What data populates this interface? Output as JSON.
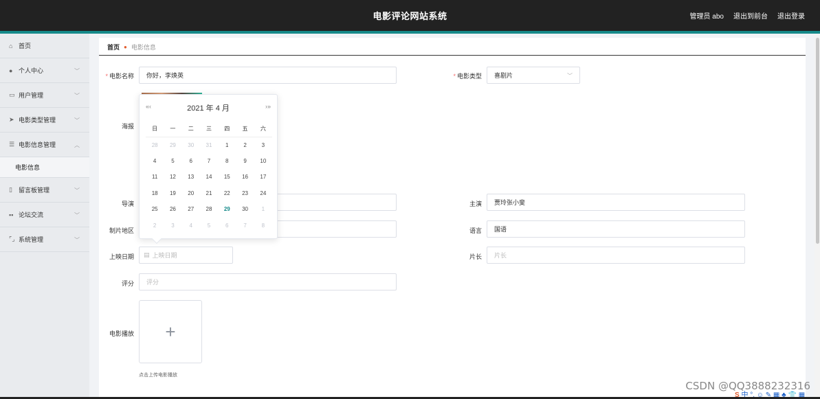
{
  "header": {
    "title": "电影评论网站系统",
    "admin": "管理员 abo",
    "to_front": "退出到前台",
    "logout": "退出登录"
  },
  "sidebar": {
    "items": [
      {
        "label": "首页",
        "icon": "home-icon"
      },
      {
        "label": "个人中心",
        "icon": "user-icon"
      },
      {
        "label": "用户管理",
        "icon": "chat-icon"
      },
      {
        "label": "电影类型管理",
        "icon": "send-icon"
      },
      {
        "label": "电影信息管理",
        "icon": "list-icon"
      },
      {
        "label": "电影信息",
        "icon": ""
      },
      {
        "label": "留言板管理",
        "icon": "phone-icon"
      },
      {
        "label": "论坛交流",
        "icon": "grid-icon"
      },
      {
        "label": "系统管理",
        "icon": "expand-icon"
      }
    ]
  },
  "breadcrumb": {
    "home": "首页",
    "current": "电影信息"
  },
  "form": {
    "name_label": "电影名称",
    "name_value": "你好，李焕英",
    "type_label": "电影类型",
    "type_value": "喜剧片",
    "poster_label": "海报",
    "director_label": "导演",
    "actor_label": "主演",
    "actor_value": "贾玲张小斐",
    "region_label": "制片地区",
    "language_label": "语言",
    "language_value": "国语",
    "date_label": "上映日期",
    "date_placeholder": "上映日期",
    "duration_label": "片长",
    "duration_placeholder": "片长",
    "score_label": "评分",
    "score_placeholder": "评分",
    "play_label": "电影播放",
    "upload_hint": "点击上传电影播放"
  },
  "calendar": {
    "title": "2021 年  4 月",
    "prev": "«‹",
    "next": "›»",
    "weekdays": [
      "日",
      "一",
      "二",
      "三",
      "四",
      "五",
      "六"
    ],
    "weeks": [
      [
        "28",
        "29",
        "30",
        "31",
        "1",
        "2",
        "3"
      ],
      [
        "4",
        "5",
        "6",
        "7",
        "8",
        "9",
        "10"
      ],
      [
        "11",
        "12",
        "13",
        "14",
        "15",
        "16",
        "17"
      ],
      [
        "18",
        "19",
        "20",
        "21",
        "22",
        "23",
        "24"
      ],
      [
        "25",
        "26",
        "27",
        "28",
        "29",
        "30",
        "1"
      ],
      [
        "2",
        "3",
        "4",
        "5",
        "6",
        "7",
        "8"
      ]
    ],
    "today": "29"
  },
  "watermark": "CSDN @QQ3888232316",
  "ime": "中 °, ☺ ✎ ▦ ♣ 👕 ▦"
}
